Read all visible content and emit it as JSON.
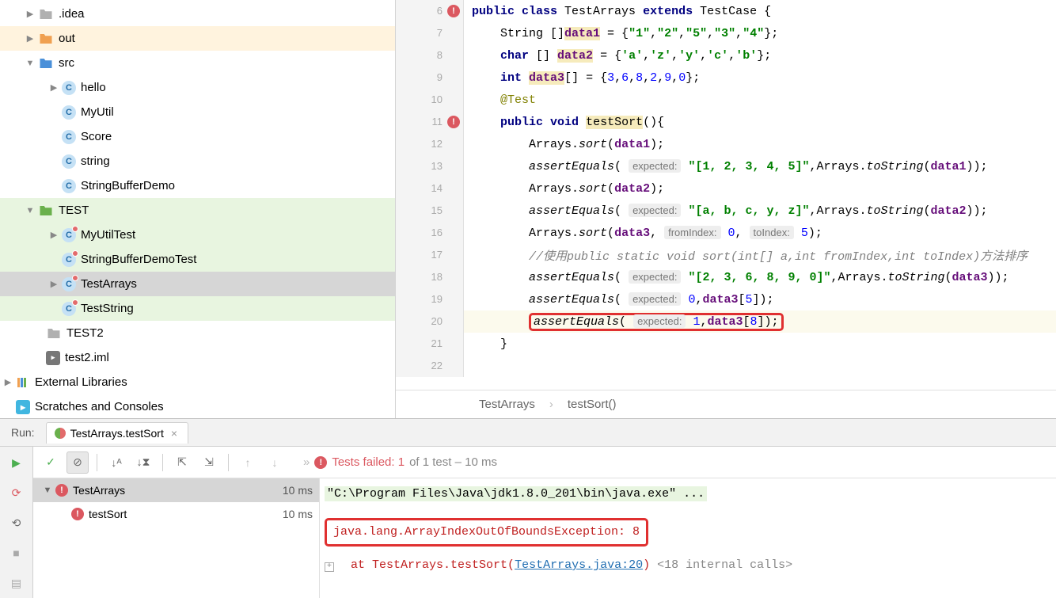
{
  "tree": {
    "idea": ".idea",
    "out": "out",
    "src": "src",
    "hello": "hello",
    "myutil": "MyUtil",
    "score": "Score",
    "string": "string",
    "sbdemo": "StringBufferDemo",
    "test_folder": "TEST",
    "myutiltest": "MyUtilTest",
    "sbdemotest": "StringBufferDemoTest",
    "testarrays": "TestArrays",
    "teststring": "TestString",
    "test2": "TEST2",
    "iml": "test2.iml",
    "extlib": "External Libraries",
    "scratch": "Scratches and Consoles"
  },
  "code": {
    "l6": "public class TestArrays extends TestCase {",
    "l7_pre": "    String []",
    "l7_field": "data1",
    "l7_post": " = {\"1\",\"2\",\"5\",\"3\",\"4\"};",
    "l8_pre": "    char [] ",
    "l8_field": "data2",
    "l8_post": " = {'a','z','y','c','b'};",
    "l9_pre": "    int ",
    "l9_field": "data3",
    "l9_post": "[] = {3,6,8,2,9,0};",
    "l10": "    @Test",
    "l11_pre": "    public void ",
    "l11_m": "testSort",
    "l11_post": "(){",
    "l12": "        Arrays.sort(data1);",
    "l13_pre": "        assertEquals( ",
    "l13_hint": "expected:",
    "l13_str": " \"[1, 2, 3, 4, 5]\"",
    "l13_post": ",Arrays.toString(data1));",
    "l14": "        Arrays.sort(data2);",
    "l15_str": " \"[a, b, c, y, z]\"",
    "l15_post": ",Arrays.toString(data2));",
    "l16_pre": "        Arrays.sort(data3, ",
    "l16_h1": "fromIndex:",
    "l16_v1": " 0",
    "l16_h2": "toIndex:",
    "l16_v2": " 5",
    "l17": "        //使用public static void sort(int[] a,int fromIndex,int toIndex)方法排序",
    "l18_str": " \"[2, 3, 6, 8, 9, 0]\"",
    "l18_post": ",Arrays.toString(data3));",
    "l19_v": " 0",
    "l19_post": ",data3[5]);",
    "l20_v": " 1",
    "l20_post": ",data3[8]);",
    "l21": "    }",
    "nums": [
      "6",
      "7",
      "8",
      "9",
      "10",
      "11",
      "12",
      "13",
      "14",
      "15",
      "16",
      "17",
      "18",
      "19",
      "20",
      "21",
      "22"
    ]
  },
  "breadcrumb": {
    "a": "TestArrays",
    "b": "testSort()"
  },
  "run": {
    "label": "Run:",
    "tab": "TestArrays.testSort",
    "status_pre": "Tests failed: 1",
    "status_post": " of 1 test – 10 ms"
  },
  "testtree": {
    "root": "TestArrays",
    "root_time": "10 ms",
    "child": "testSort",
    "child_time": "10 ms"
  },
  "console": {
    "cmd": "\"C:\\Program Files\\Java\\jdk1.8.0_201\\bin\\java.exe\" ...",
    "err": "java.lang.ArrayIndexOutOfBoundsException: 8",
    "trace_pre": "at TestArrays.testSort(",
    "trace_link": "TestArrays.java:20",
    "trace_post": ") ",
    "trace_gray": "<18 internal calls>"
  }
}
